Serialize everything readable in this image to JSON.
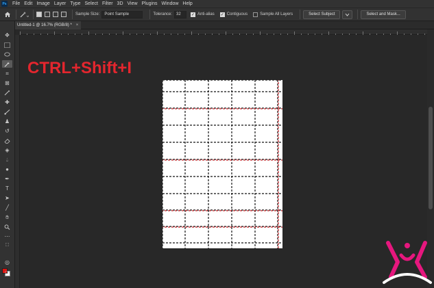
{
  "menu": {
    "logo": "Ps",
    "items": [
      "File",
      "Edit",
      "Image",
      "Layer",
      "Type",
      "Select",
      "Filter",
      "3D",
      "View",
      "Plugins",
      "Window",
      "Help"
    ]
  },
  "options": {
    "sample_size_label": "Sample Size:",
    "sample_size_value": "Point Sample",
    "tolerance_label": "Tolerance:",
    "tolerance_value": "32",
    "anti_alias_label": "Anti-alias",
    "contiguous_label": "Contiguous",
    "sample_all_layers_label": "Sample All Layers",
    "select_subject_label": "Select Subject",
    "select_and_mask_label": "Select and Mask..."
  },
  "document": {
    "tab_title": "Untitled-1 @ 16.7% (RGB/8) *",
    "close_glyph": "×"
  },
  "overlay": {
    "shortcut_text": "CTRL+Shift+I"
  },
  "colors": {
    "foreground": "#e0140f",
    "background": "#ffffff",
    "overlay_text": "#e3262e",
    "logo": "#e6177e"
  }
}
